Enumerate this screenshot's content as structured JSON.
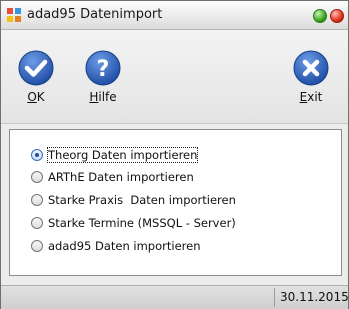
{
  "window": {
    "title": "adad95 Datenimport"
  },
  "toolbar": {
    "ok": {
      "label_ul": "O",
      "label_rest": "K"
    },
    "help": {
      "label_ul": "H",
      "label_rest": "ilfe"
    },
    "exit": {
      "label_ul": "E",
      "label_rest": "xit"
    }
  },
  "options": [
    {
      "label": "Theorg Daten importieren",
      "checked": true
    },
    {
      "label": "ARThE Daten importieren",
      "checked": false
    },
    {
      "label": "Starke Praxis  Daten importieren",
      "checked": false
    },
    {
      "label": "Starke Termine (MSSQL - Server)",
      "checked": false
    },
    {
      "label": "adad95 Daten importieren",
      "checked": false
    }
  ],
  "status": {
    "date": "30.11.2015"
  },
  "colors": {
    "accent_blue": "#2f5fb3",
    "exit_blue": "#1f4ea6"
  }
}
